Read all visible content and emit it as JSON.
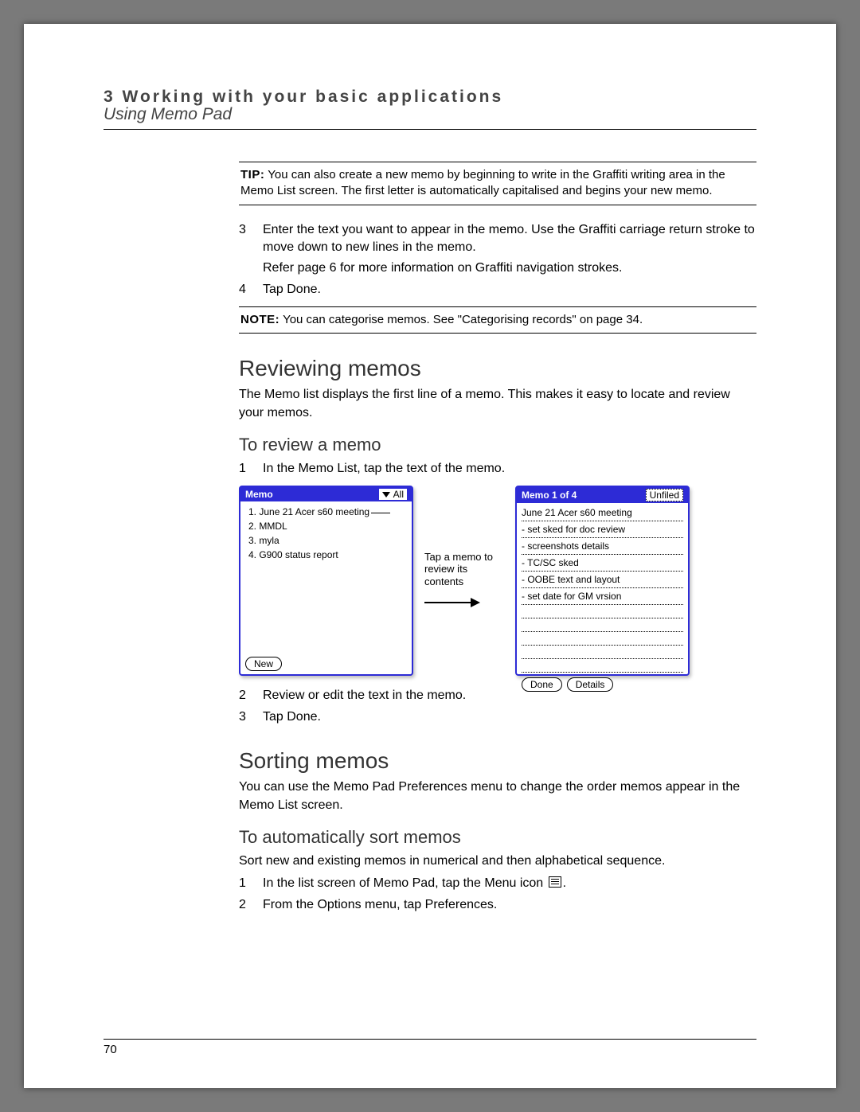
{
  "header": {
    "chapter": "3 Working with your basic applications",
    "section_title": "Using Memo Pad"
  },
  "tip": {
    "label": "TIP:",
    "text": "You can also create a new memo by beginning to write in the Graffiti writing area in the Memo List screen. The first letter is automatically capitalised and begins your new memo."
  },
  "steps_a": [
    {
      "n": "3",
      "text": "Enter the text you want to appear in the memo. Use the Graffiti carriage return stroke to move down to new lines in the memo."
    },
    {
      "n": "",
      "text": "Refer page 6 for more information on Graffiti navigation strokes."
    },
    {
      "n": "4",
      "text": "Tap Done."
    }
  ],
  "note": {
    "label": "NOTE:",
    "text": "You can categorise memos. See \"Categorising records\" on page 34."
  },
  "reviewing": {
    "title": "Reviewing memos",
    "intro": "The Memo list displays the first line of a memo. This makes it easy to locate and review your memos.",
    "howto_title": "To review a memo",
    "steps_before": [
      {
        "n": "1",
        "text": "In the Memo List, tap the text of the memo."
      }
    ],
    "steps_after": [
      {
        "n": "2",
        "text": "Review or edit the text in the memo."
      },
      {
        "n": "3",
        "text": "Tap Done."
      }
    ],
    "annot": "Tap a memo to review its contents"
  },
  "memo_list_panel": {
    "title": "Memo",
    "filter": "All",
    "items": [
      "1.  June 21 Acer s60 meeting",
      "2.  MMDL",
      "3.  myla",
      "4.  G900 status report"
    ],
    "new_btn": "New"
  },
  "memo_detail_panel": {
    "title": "Memo 1 of 4",
    "category": "Unfiled",
    "lines": [
      "June 21 Acer s60 meeting",
      "- set sked for doc review",
      "- screenshots details",
      "- TC/SC sked",
      "- OOBE text and layout",
      "- set date for GM vrsion"
    ],
    "done_btn": "Done",
    "details_btn": "Details"
  },
  "sorting": {
    "title": "Sorting memos",
    "intro": "You can use the Memo Pad Preferences menu to change the order memos appear in the Memo List screen.",
    "howto_title": "To automatically sort memos",
    "lead": "Sort new and existing memos in numerical and then alphabetical sequence.",
    "steps": [
      {
        "n": "1",
        "text_a": "In the list screen of Memo Pad, tap the Menu icon ",
        "text_b": "."
      },
      {
        "n": "2",
        "text": "From the Options menu, tap Preferences."
      }
    ]
  },
  "page_number": "70"
}
